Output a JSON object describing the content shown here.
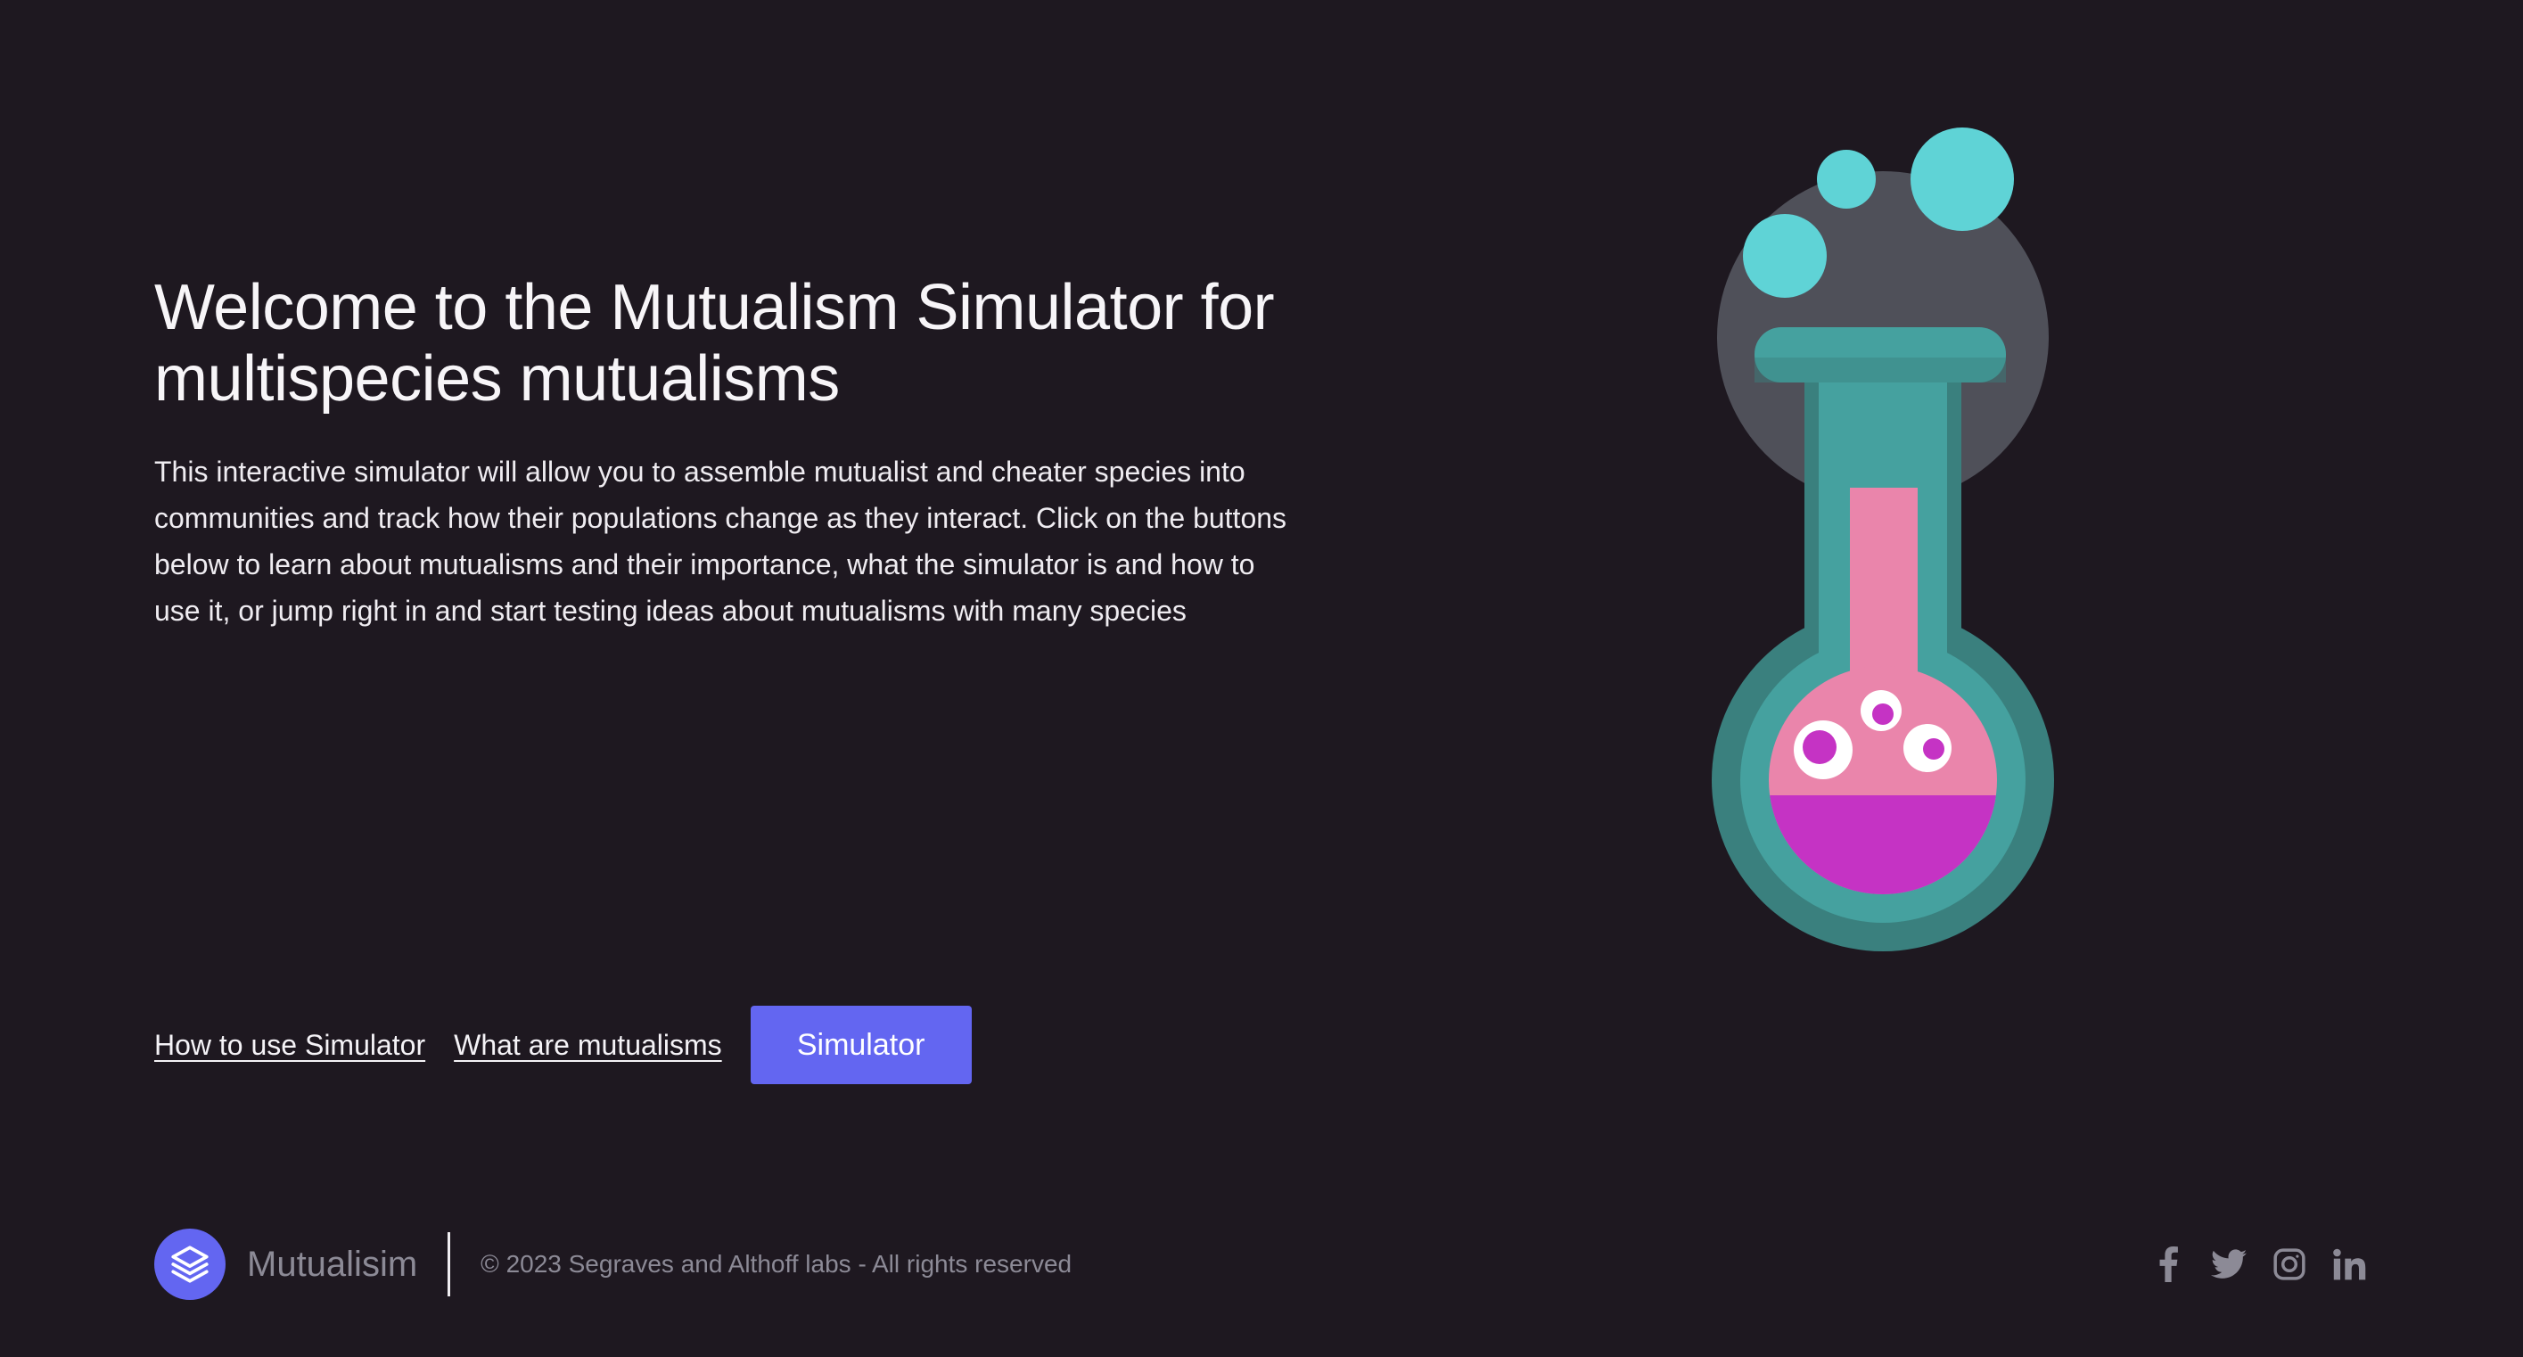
{
  "hero": {
    "title": "Welcome to the Mutualism Simulator for multispecies mutualisms",
    "description": "This interactive simulator will allow you to assemble mutualist and cheater species into communities and track how their populations change as they interact. Click on the buttons below to learn about mutualisms and their importance, what the simulator is and how to use it, or jump right in and start testing ideas about mutualisms with many species",
    "links": {
      "how_to_use": "How to use Simulator",
      "what_are": "What are mutualisms"
    },
    "cta_label": "Simulator"
  },
  "illustration": {
    "icon": "flask-icon",
    "colors": {
      "bubble": "#5fd3d6",
      "glass_back": "#4f5059",
      "glass_dark": "#3a807e",
      "glass": "#45a19f",
      "liquid_top": "#ea85ab",
      "liquid_bottom": "#c533c4"
    }
  },
  "footer": {
    "brand": "Mutualisim",
    "copyright": "© 2023 Segraves and Althoff labs - All rights reserved",
    "social_icons": [
      "facebook-icon",
      "twitter-icon",
      "instagram-icon",
      "linkedin-icon"
    ]
  },
  "colors": {
    "background": "#1e1820",
    "accent": "#6366f1",
    "muted_text": "#8c8a96"
  }
}
